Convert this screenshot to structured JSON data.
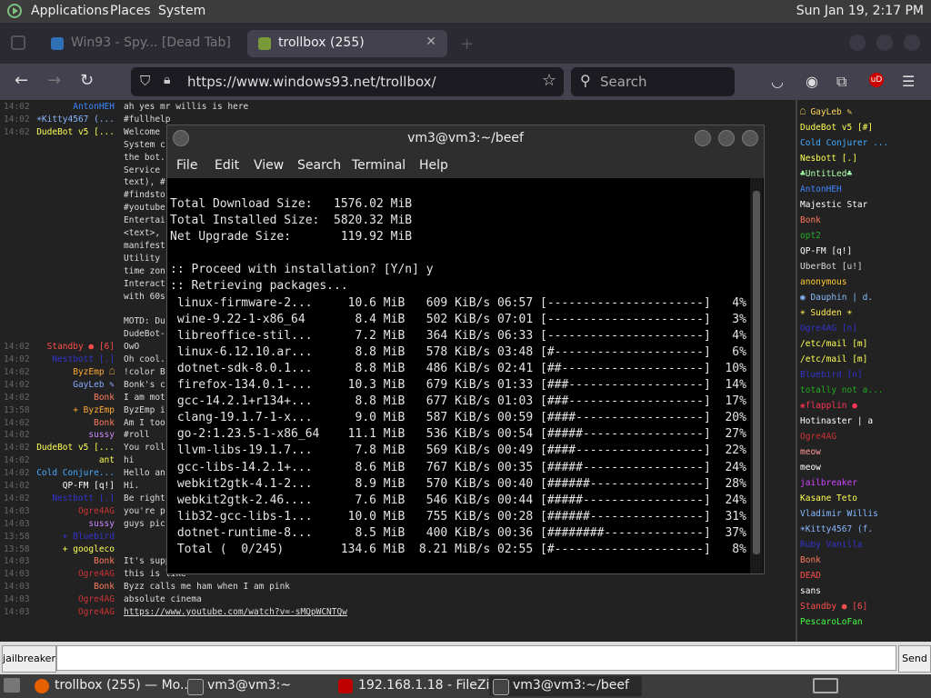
{
  "panel": {
    "applications": "Applications",
    "places": "Places",
    "system": "System",
    "clock": "Sun Jan 19,  2:17 PM"
  },
  "browser": {
    "tab1_title": "Win93 - Spy... [Dead Tab]",
    "tab2_title": "trollbox (255)",
    "url": "https://www.windows93.net/trollbox/",
    "search_placeholder": "Search",
    "accent": "#42414d"
  },
  "chat": {
    "rows": [
      {
        "time": "14:02",
        "nick": "AntonHEH",
        "color": "#3d86ff",
        "msg": "ah yes mr willis is here"
      },
      {
        "time": "14:02",
        "nick": "☀Kitty4567 (...",
        "color": "#8ab4ff",
        "msg": "#fullhelp"
      },
      {
        "time": "14:02",
        "nick": "DudeBot v5 [...",
        "color": "#ffff55",
        "msg": "Welcome"
      },
      {
        "time": "",
        "nick": "",
        "color": "#ddd",
        "msg": "System c"
      },
      {
        "time": "",
        "nick": "",
        "color": "#ddd",
        "msg": "the bot."
      },
      {
        "time": "",
        "nick": "",
        "color": "#ddd",
        "msg": "Service"
      },
      {
        "time": "",
        "nick": "",
        "color": "#ddd",
        "msg": "text), #"
      },
      {
        "time": "",
        "nick": "",
        "color": "#ddd",
        "msg": "#findsto"
      },
      {
        "time": "",
        "nick": "",
        "color": "#ddd",
        "msg": "#youtube"
      },
      {
        "time": "",
        "nick": "",
        "color": "#ddd",
        "msg": "Entertai"
      },
      {
        "time": "",
        "nick": "",
        "color": "#ddd",
        "msg": "<text>,"
      },
      {
        "time": "",
        "nick": "",
        "color": "#ddd",
        "msg": "manifest"
      },
      {
        "time": "",
        "nick": "",
        "color": "#ddd",
        "msg": "Utility"
      },
      {
        "time": "",
        "nick": "",
        "color": "#ddd",
        "msg": "time zon"
      },
      {
        "time": "",
        "nick": "",
        "color": "#ddd",
        "msg": "Interact"
      },
      {
        "time": "",
        "nick": "",
        "color": "#ddd",
        "msg": "with 60s"
      },
      {
        "time": "",
        "nick": "",
        "color": "#ddd",
        "msg": ""
      },
      {
        "time": "",
        "nick": "",
        "color": "#ddd",
        "msg": "MOTD: Du"
      },
      {
        "time": "",
        "nick": "",
        "color": "#ddd",
        "msg": "DudeBot-"
      },
      {
        "time": "14:02",
        "nick": "Standby ● [6]",
        "color": "#ff4d4d",
        "msg": "OwO"
      },
      {
        "time": "14:02",
        "nick": "Nestbott [.]",
        "color": "#3333cc",
        "msg": "Oh cool."
      },
      {
        "time": "14:02",
        "nick": "ByzEmp ☖",
        "color": "#ffaa33",
        "msg": "!color B"
      },
      {
        "time": "14:02",
        "nick": "GayLeb ✎",
        "color": "#88aaff",
        "msg": "Bonk's c"
      },
      {
        "time": "14:02",
        "nick": "Bonk",
        "color": "#ff7b5c",
        "msg": "I am mot"
      },
      {
        "time": "13:58",
        "nick": "+ ByzEmp",
        "color": "#ffaa33",
        "msg": "ByzEmp i"
      },
      {
        "time": "14:02",
        "nick": "Bonk",
        "color": "#ff7b5c",
        "msg": "Am I too"
      },
      {
        "time": "14:02",
        "nick": "sussy",
        "color": "#cc88ff",
        "msg": "#roll"
      },
      {
        "time": "14:02",
        "nick": "DudeBot v5 [...",
        "color": "#ffff55",
        "msg": "You roll"
      },
      {
        "time": "14:02",
        "nick": "ant",
        "color": "#ffff55",
        "msg": "hi"
      },
      {
        "time": "14:02",
        "nick": "Cold Conjure...",
        "color": "#44aaff",
        "msg": "Hello an"
      },
      {
        "time": "14:02",
        "nick": "QP-FM [q!]",
        "color": "#ffffff",
        "msg": "Hi."
      },
      {
        "time": "14:02",
        "nick": "Nestbott [.]",
        "color": "#3333cc",
        "msg": "Be right"
      },
      {
        "time": "14:03",
        "nick": "Ogre4AG",
        "color": "#cc3333",
        "msg": "you're p"
      },
      {
        "time": "14:03",
        "nick": "sussy",
        "color": "#cc88ff",
        "msg": "guys pic"
      },
      {
        "time": "13:58",
        "nick": "+ Bluebird",
        "color": "#3333cc",
        "msg": ""
      },
      {
        "time": "13:58",
        "nick": "+ googleco",
        "color": "#ffff55",
        "msg": ""
      },
      {
        "time": "14:03",
        "nick": "Bonk",
        "color": "#ff7b5c",
        "msg": "It's supposed to be coral but pinker"
      },
      {
        "time": "14:03",
        "nick": "Ogre4AG",
        "color": "#cc3333",
        "msg": "this is like"
      },
      {
        "time": "14:03",
        "nick": "Bonk",
        "color": "#ff7b5c",
        "msg": "Byzz calls me ham when I am pink"
      },
      {
        "time": "14:03",
        "nick": "Ogre4AG",
        "color": "#cc3333",
        "msg": "absolute cinema"
      },
      {
        "time": "14:03",
        "nick": "Ogre4AG",
        "color": "#cc3333",
        "msg": "https://www.youtube.com/watch?v=-sMQpWCNTQw"
      }
    ]
  },
  "users": [
    {
      "name": "☖ GayLeb ✎",
      "color": "#ffd75f"
    },
    {
      "name": "DudeBot v5 [#]",
      "color": "#ffff55"
    },
    {
      "name": "Cold Conjurer ...",
      "color": "#44aaff"
    },
    {
      "name": "Nesbott [.]",
      "color": "#ffff55"
    },
    {
      "name": "♣UntitLed♣",
      "color": "#aaffaa"
    },
    {
      "name": "AntonHEH",
      "color": "#3d86ff"
    },
    {
      "name": "Majestic Star",
      "color": "#ffffff"
    },
    {
      "name": "Bonk",
      "color": "#ff7b5c"
    },
    {
      "name": "opt2",
      "color": "#22aa22"
    },
    {
      "name": "QP-FM [q!]",
      "color": "#ffffff"
    },
    {
      "name": "UberBot [u!]",
      "color": "#dddddd"
    },
    {
      "name": "anonymous",
      "color": "#ffcc33"
    },
    {
      "name": "◉ Dauphin | d.",
      "color": "#88bbff"
    },
    {
      "name": "☀ Sudden ☀",
      "color": "#ffee55"
    },
    {
      "name": "Ogre4AG [n]",
      "color": "#3333cc"
    },
    {
      "name": "/etc/mail [m]",
      "color": "#ffff55"
    },
    {
      "name": "/etc/mail [m]",
      "color": "#ffff55"
    },
    {
      "name": "Bluebird [n]",
      "color": "#3333cc"
    },
    {
      "name": "totally not a...",
      "color": "#22aa22"
    },
    {
      "name": "❀flapplin ●",
      "color": "#ff3355"
    },
    {
      "name": "Hotinaster | a",
      "color": "#ffffff"
    },
    {
      "name": "Ogre4AG",
      "color": "#cc3333"
    },
    {
      "name": "meow",
      "color": "#ff9999"
    },
    {
      "name": "meow",
      "color": "#ffffff"
    },
    {
      "name": "jailbreaker",
      "color": "#cc44ff"
    },
    {
      "name": "Kasane Teto",
      "color": "#ffff55"
    },
    {
      "name": "Vladimir Willis",
      "color": "#88bbff"
    },
    {
      "name": "☀Kitty4567 (f.",
      "color": "#8ab4ff"
    },
    {
      "name": "Ruby Vanilla",
      "color": "#3333cc"
    },
    {
      "name": "Bonk",
      "color": "#ff7b5c"
    },
    {
      "name": "DEAD",
      "color": "#ff4d4d"
    },
    {
      "name": "sans",
      "color": "#ffffff"
    },
    {
      "name": "Standby ● [6]",
      "color": "#ff4d4d"
    },
    {
      "name": "PescaroLoFan",
      "color": "#44ff44"
    }
  ],
  "input": {
    "nick": "jailbreaker",
    "send": "Send"
  },
  "terminal": {
    "title": "vm3@vm3:~/beef",
    "menu": [
      "File",
      "Edit",
      "View",
      "Search",
      "Terminal",
      "Help"
    ],
    "lines": [
      "Total Download Size:   1576.02 MiB",
      "Total Installed Size:  5820.32 MiB",
      "Net Upgrade Size:       119.92 MiB",
      "",
      ":: Proceed with installation? [Y/n] y",
      ":: Retrieving packages...",
      " linux-firmware-2...     10.6 MiB   609 KiB/s 06:57 [----------------------]   4%",
      " wine-9.22-1-x86_64       8.4 MiB   502 KiB/s 07:01 [----------------------]   3%",
      " libreoffice-stil...      7.2 MiB   364 KiB/s 06:33 [----------------------]   4%",
      " linux-6.12.10.ar...      8.8 MiB   578 KiB/s 03:48 [#---------------------]   6%",
      " dotnet-sdk-8.0.1...      8.8 MiB   486 KiB/s 02:41 [##--------------------]  10%",
      " firefox-134.0.1-...     10.3 MiB   679 KiB/s 01:33 [###-------------------]  14%",
      " gcc-14.2.1+r134+...      8.8 MiB   677 KiB/s 01:03 [###-------------------]  17%",
      " clang-19.1.7-1-x...      9.0 MiB   587 KiB/s 00:59 [####------------------]  20%",
      " go-2:1.23.5-1-x86_64    11.1 MiB   536 KiB/s 00:54 [#####-----------------]  27%",
      " llvm-libs-19.1.7...      7.8 MiB   569 KiB/s 00:49 [####------------------]  22%",
      " gcc-libs-14.2.1+...      8.6 MiB   767 KiB/s 00:35 [#####-----------------]  24%",
      " webkit2gtk-4.1-2...      8.9 MiB   570 KiB/s 00:40 [######----------------]  28%",
      " webkit2gtk-2.46....      7.6 MiB   546 KiB/s 00:44 [#####-----------------]  24%",
      " lib32-gcc-libs-1...     10.0 MiB   755 KiB/s 00:28 [######----------------]  31%",
      " dotnet-runtime-8...      8.5 MiB   400 KiB/s 00:36 [########--------------]  37%",
      " Total (  0/245)        134.6 MiB  8.21 MiB/s 02:55 [#---------------------]   8%"
    ]
  },
  "taskbar": [
    {
      "title": "trollbox (255) — Mo...",
      "icon_color": "#e66000"
    },
    {
      "title": "vm3@vm3:~",
      "icon_color": "#444"
    },
    {
      "title": "192.168.1.18 - FileZilla",
      "icon_color": "#bf0000"
    },
    {
      "title": "vm3@vm3:~/beef",
      "icon_color": "#444"
    }
  ]
}
